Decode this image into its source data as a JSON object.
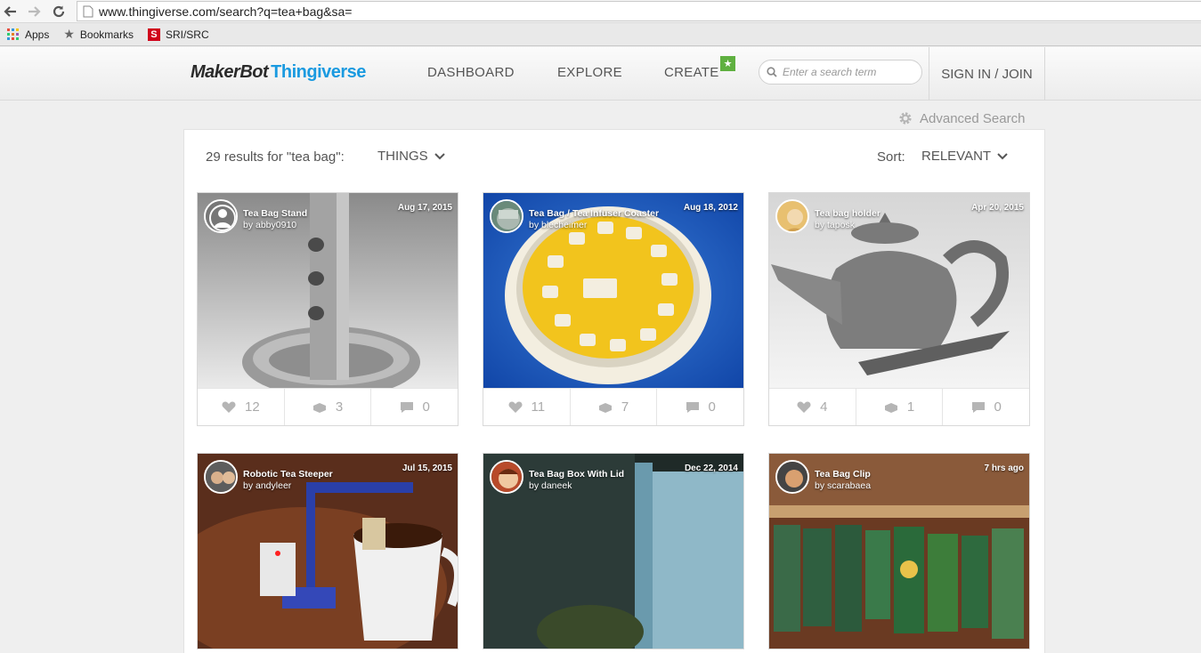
{
  "browser": {
    "url": "www.thingiverse.com/search?q=tea+bag&sa=",
    "bookmarks": [
      "Apps",
      "Bookmarks",
      "SRI/SRC"
    ]
  },
  "header": {
    "logo_left": "MakerBot",
    "logo_right": "Thingiverse",
    "nav": [
      "DASHBOARD",
      "EXPLORE",
      "CREATE"
    ],
    "search_placeholder": "Enter a search term",
    "sign_in": "SIGN IN / JOIN",
    "brand_color": "#1a9ae0",
    "badge_color": "#5fb040"
  },
  "advanced_search": "Advanced Search",
  "results": {
    "count_text": "29 results for \"tea bag\":",
    "filter": "THINGS",
    "sort_label": "Sort:",
    "sort_value": "RELEVANT"
  },
  "cards": [
    {
      "title": "Tea Bag Stand",
      "author": "by abby0910",
      "date": "Aug 17, 2015",
      "likes": "12",
      "collects": "3",
      "comments": "0"
    },
    {
      "title": "Tea Bag / Tea Infuser Coaster",
      "author": "by blecheimer",
      "date": "Aug 18, 2012",
      "likes": "11",
      "collects": "7",
      "comments": "0"
    },
    {
      "title": "Tea bag holder",
      "author": "by taposk",
      "date": "Apr 20, 2015",
      "likes": "4",
      "collects": "1",
      "comments": "0"
    },
    {
      "title": "Robotic Tea Steeper",
      "author": "by andyleer",
      "date": "Jul 15, 2015"
    },
    {
      "title": "Tea Bag Box With Lid",
      "author": "by daneek",
      "date": "Dec 22, 2014"
    },
    {
      "title": "Tea Bag Clip",
      "author": "by scarabaea",
      "date": "7 hrs ago"
    }
  ]
}
